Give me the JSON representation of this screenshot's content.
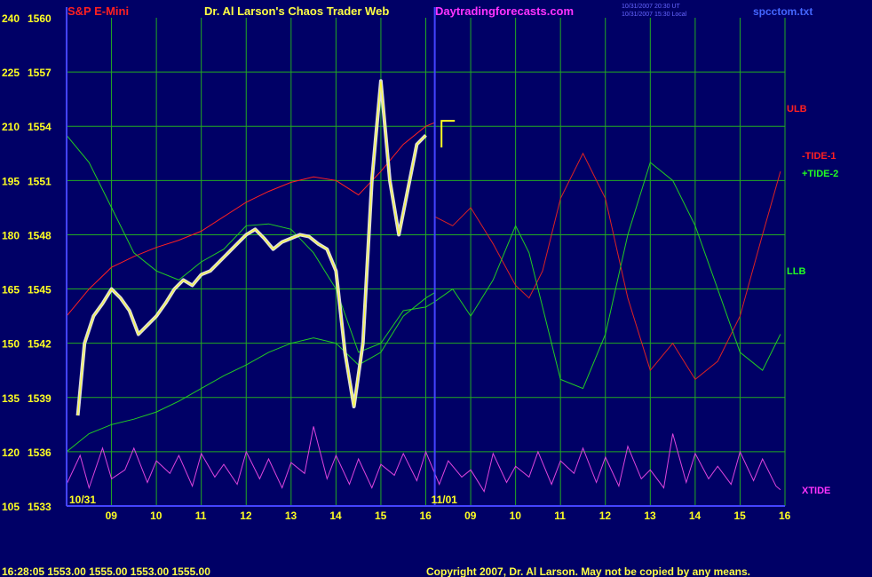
{
  "header": {
    "instrument": "S&P E-Mini",
    "title": "Dr. Al Larson's Chaos Trader Web",
    "site": "Daytradingforecasts.com",
    "time_line1": "10/31/2007 20:30 UT",
    "time_line2": "10/31/2007 15:30 Local",
    "filename": "spcctom.txt"
  },
  "footer": {
    "quote": "16:28:05  1553.00 1555.00 1553.00 1555.00",
    "copyright": "Copyright 2007, Dr. Al Larson. May not be copied by any means."
  },
  "chart_data": {
    "type": "line",
    "title": "S&P E-Mini",
    "y_axis_left_labels": [
      "240",
      "225",
      "210",
      "195",
      "180",
      "165",
      "150",
      "135",
      "120",
      "105"
    ],
    "y_axis_price_labels": [
      "1560",
      "1557",
      "1554",
      "1551",
      "1548",
      "1545",
      "1542",
      "1539",
      "1536",
      "1533"
    ],
    "ylim": [
      1533,
      1560
    ],
    "x_tick_labels": [
      "09",
      "10",
      "11",
      "12",
      "13",
      "14",
      "15",
      "16",
      "09",
      "10",
      "11",
      "12",
      "13",
      "14",
      "15",
      "16"
    ],
    "date_labels": [
      "10/31",
      "11/01"
    ],
    "grid": true,
    "price_x": [
      8.25,
      8.4,
      8.6,
      8.8,
      9.0,
      9.2,
      9.4,
      9.6,
      9.8,
      10.0,
      10.2,
      10.4,
      10.6,
      10.8,
      11.0,
      11.2,
      11.4,
      11.6,
      11.8,
      12.0,
      12.2,
      12.4,
      12.6,
      12.8,
      13.0,
      13.2,
      13.4,
      13.6,
      13.8,
      14.0,
      14.2,
      14.4,
      14.6,
      14.8,
      15.0,
      15.2,
      15.4,
      15.6,
      15.8,
      16.0
    ],
    "price": [
      1538.0,
      1542.0,
      1543.5,
      1544.2,
      1545.0,
      1544.5,
      1543.8,
      1542.5,
      1543.0,
      1543.5,
      1544.2,
      1545.0,
      1545.5,
      1545.2,
      1545.8,
      1546.0,
      1546.5,
      1547.0,
      1547.5,
      1548.0,
      1548.3,
      1547.8,
      1547.2,
      1547.6,
      1547.8,
      1548.0,
      1547.9,
      1547.5,
      1547.2,
      1546.0,
      1541.5,
      1538.5,
      1542.0,
      1551.0,
      1556.5,
      1551.0,
      1548.0,
      1550.5,
      1553.0,
      1553.5
    ],
    "series": [
      {
        "name": "ULB",
        "color": "#ff2020",
        "x": [
          8.0,
          8.5,
          9.0,
          9.5,
          10.0,
          10.5,
          11.0,
          11.5,
          12.0,
          12.5,
          13.0,
          13.5,
          14.0,
          14.5,
          15.0,
          15.5,
          16.0,
          16.2
        ],
        "values": [
          1543.5,
          1545.0,
          1546.2,
          1546.8,
          1547.3,
          1547.7,
          1548.2,
          1549.0,
          1549.8,
          1550.4,
          1550.9,
          1551.2,
          1551.0,
          1550.2,
          1551.5,
          1553.0,
          1554.0,
          1554.2
        ]
      },
      {
        "name": "LLB",
        "color": "#22cc22",
        "x": [
          8.0,
          8.5,
          9.0,
          9.5,
          10.0,
          10.5,
          11.0,
          11.5,
          12.0,
          12.5,
          13.0,
          13.5,
          14.0,
          14.5,
          15.0,
          15.5,
          16.0,
          16.2
        ],
        "values": [
          1536.0,
          1537.0,
          1537.5,
          1537.8,
          1538.2,
          1538.8,
          1539.5,
          1540.2,
          1540.8,
          1541.5,
          1542.0,
          1542.3,
          1542.0,
          1540.8,
          1541.5,
          1543.5,
          1544.5,
          1544.8
        ]
      },
      {
        "name": "-TIDE-1",
        "color": "#dd2222",
        "x": [
          16.2,
          16.6,
          17.0,
          17.5,
          18.0,
          18.3,
          18.6,
          19.0,
          19.5,
          20.0,
          20.5,
          21.0,
          21.5,
          22.0,
          22.5,
          23.0,
          23.5,
          23.9
        ],
        "values": [
          1549.0,
          1548.5,
          1549.5,
          1547.5,
          1545.2,
          1544.5,
          1546.0,
          1550.0,
          1552.5,
          1550.0,
          1544.5,
          1540.5,
          1542.0,
          1540.0,
          1541.0,
          1543.5,
          1548.0,
          1551.5
        ]
      },
      {
        "name": "+TIDE-2",
        "color": "#22cc22",
        "x": [
          8.0,
          8.5,
          9.0,
          9.5,
          10.0,
          10.5,
          11.0,
          11.5,
          12.0,
          12.5,
          13.0,
          13.5,
          14.0,
          14.5,
          15.0,
          15.5,
          16.0,
          16.2,
          16.6,
          17.0,
          17.5,
          18.0,
          18.3,
          18.6,
          19.0,
          19.5,
          20.0,
          20.5,
          21.0,
          21.5,
          22.0,
          22.5,
          23.0,
          23.5,
          23.9
        ],
        "values": [
          1553.5,
          1552.0,
          1549.5,
          1547.0,
          1546.0,
          1545.5,
          1546.5,
          1547.2,
          1548.5,
          1548.6,
          1548.3,
          1547.0,
          1545.0,
          1541.5,
          1542.0,
          1543.8,
          1544.0,
          1544.3,
          1545.0,
          1543.5,
          1545.5,
          1548.5,
          1547.0,
          1544.0,
          1540.0,
          1539.5,
          1542.5,
          1548.0,
          1552.0,
          1551.0,
          1548.5,
          1545.0,
          1541.5,
          1540.5,
          1542.5
        ]
      },
      {
        "name": "XTIDE",
        "color": "#dd44dd",
        "x": [
          8.0,
          8.3,
          8.5,
          8.8,
          9.0,
          9.3,
          9.5,
          9.8,
          10.0,
          10.3,
          10.5,
          10.8,
          11.0,
          11.3,
          11.5,
          11.8,
          12.0,
          12.3,
          12.5,
          12.8,
          13.0,
          13.3,
          13.5,
          13.8,
          14.0,
          14.3,
          14.5,
          14.8,
          15.0,
          15.3,
          15.5,
          15.8,
          16.0,
          16.3,
          16.5,
          16.8,
          17.0,
          17.3,
          17.5,
          17.8,
          18.0,
          18.3,
          18.5,
          18.8,
          19.0,
          19.3,
          19.5,
          19.8,
          20.0,
          20.3,
          20.5,
          20.8,
          21.0,
          21.3,
          21.5,
          21.8,
          22.0,
          22.3,
          22.5,
          22.8,
          23.0,
          23.3,
          23.5,
          23.8,
          23.9
        ],
        "values": [
          1534.2,
          1535.8,
          1534.0,
          1536.2,
          1534.5,
          1535.0,
          1536.2,
          1534.3,
          1535.5,
          1534.8,
          1535.8,
          1534.1,
          1535.9,
          1534.6,
          1535.3,
          1534.2,
          1536.0,
          1534.5,
          1535.6,
          1534.0,
          1535.4,
          1534.8,
          1537.4,
          1534.5,
          1535.8,
          1534.2,
          1535.6,
          1534.0,
          1535.3,
          1534.7,
          1535.9,
          1534.4,
          1536.0,
          1534.2,
          1535.5,
          1534.6,
          1535.0,
          1533.8,
          1535.9,
          1534.3,
          1535.2,
          1534.6,
          1536.0,
          1534.2,
          1535.5,
          1534.8,
          1536.2,
          1534.3,
          1535.7,
          1534.1,
          1536.3,
          1534.5,
          1535.0,
          1534.0,
          1537.0,
          1534.3,
          1535.9,
          1534.5,
          1535.2,
          1534.2,
          1536.0,
          1534.4,
          1535.6,
          1534.1,
          1533.9
        ]
      }
    ]
  },
  "labels": {
    "ulb": "ULB",
    "tide1": "-TIDE-1",
    "tide2": "+TIDE-2",
    "llb": "LLB",
    "xtide": "XTIDE"
  },
  "colors": {
    "background": "#000066",
    "grid": "#22aa22",
    "axis": "#4444ff",
    "white": "#ffffff",
    "yellow": "#ffff22",
    "red": "#ff2020",
    "green": "#22ff22",
    "magenta": "#ff33ff"
  }
}
